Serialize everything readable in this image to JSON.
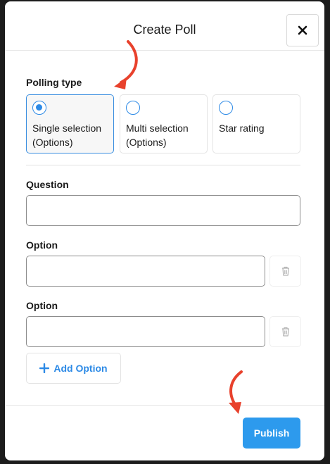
{
  "modal": {
    "title": "Create Poll",
    "close_icon": "close-icon"
  },
  "polling_type": {
    "label": "Polling type",
    "options": [
      {
        "label": "Single selection (Options)",
        "selected": true
      },
      {
        "label": "Multi selection (Options)",
        "selected": false
      },
      {
        "label": "Star rating",
        "selected": false
      }
    ]
  },
  "question": {
    "label": "Question",
    "value": ""
  },
  "options": [
    {
      "label": "Option",
      "value": "",
      "delete_icon": "trash-icon"
    },
    {
      "label": "Option",
      "value": "",
      "delete_icon": "trash-icon"
    }
  ],
  "add_option": {
    "label": "Add Option",
    "icon": "plus-icon"
  },
  "footer": {
    "publish_label": "Publish"
  },
  "colors": {
    "accent": "#2d8ae6",
    "publish_button": "#2d9aed",
    "annotation_arrow": "#e8412c"
  }
}
